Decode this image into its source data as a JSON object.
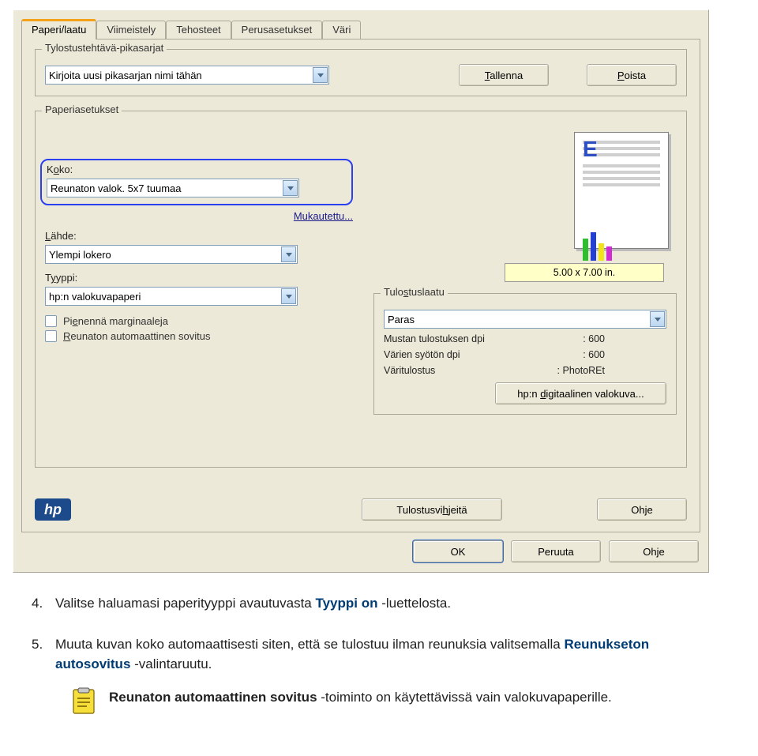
{
  "tabs": [
    "Paperi/laatu",
    "Viimeistely",
    "Tehosteet",
    "Perusasetukset",
    "Väri"
  ],
  "active_tab": 0,
  "quicksets": {
    "legend": "Tylostustehtävä-pikasarjat",
    "value": "Kirjoita uusi pikasarjan nimi tähän",
    "save": "Tallenna",
    "delete": "Poista"
  },
  "paper": {
    "legend": "Paperiasetukset",
    "size_label": "Koko:",
    "size_value": "Reunaton valok. 5x7 tuumaa",
    "custom_link": "Mukautettu...",
    "source_label": "Lähde:",
    "source_value": "Ylempi lokero",
    "type_label": "Tyyppi:",
    "type_value": "hp:n valokuvapaperi",
    "cb1": "Pienennä marginaaleja",
    "cb2": "Reunaton automaattinen sovitus",
    "dims": "5.00 x 7.00 in."
  },
  "quality": {
    "legend": "Tulostuslaatu",
    "value": "Paras",
    "line1_label": "Mustan tulostuksen dpi",
    "line1_value": ": 600",
    "line2_label": "Värien syötön dpi",
    "line2_value": ": 600",
    "line3_label": "Väritulostus",
    "line3_value": ": PhotoREt",
    "btn": "hp:n digitaalinen valokuva..."
  },
  "bottom": {
    "tips": "Tulostusvihjeitä",
    "help": "Ohje"
  },
  "footer": {
    "ok": "OK",
    "cancel": "Peruuta",
    "help": "Ohje"
  },
  "steps": {
    "s4_num": "4.",
    "s4_a": "Valitse haluamasi paperityyppi avautuvasta ",
    "s4_b": "Tyyppi on",
    "s4_c": " -luettelosta.",
    "s5_num": "5.",
    "s5_a": "Muuta kuvan koko automaattisesti siten, että se tulostuu ilman reunuksia valitsemalla ",
    "s5_b": "Reunukseton autosovitus",
    "s5_c": " -valintaruutu.",
    "note_a": "Reunaton automaattinen sovitus",
    "note_b": " -toiminto on käytettävissä vain valokuvapaperille."
  }
}
